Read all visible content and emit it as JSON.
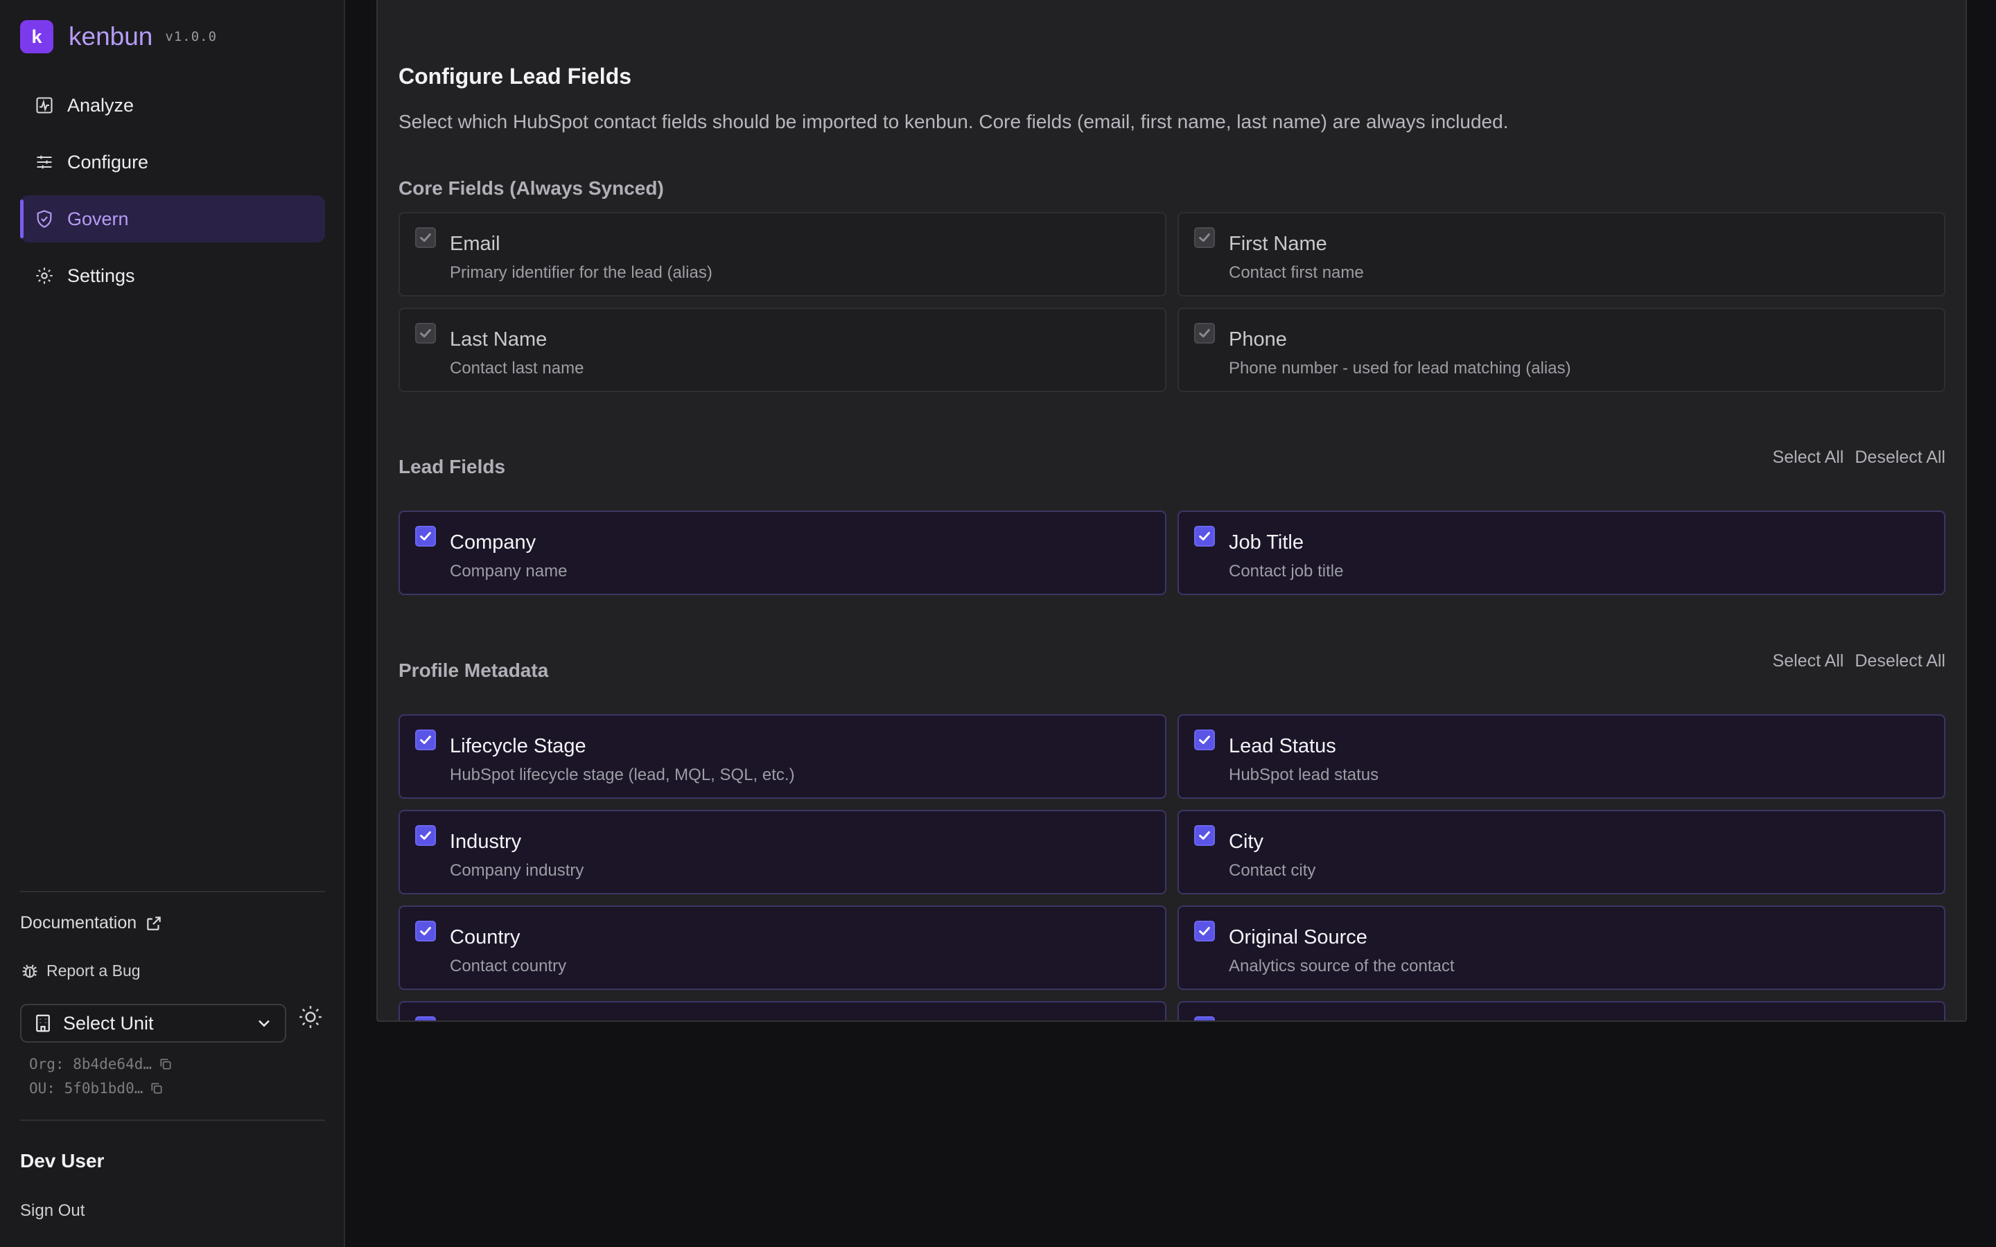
{
  "app": {
    "name": "kenbun",
    "version": "v1.0.0",
    "logo_letter": "k"
  },
  "nav": [
    {
      "label": "Analyze",
      "icon": "analyze-icon",
      "active": false
    },
    {
      "label": "Configure",
      "icon": "sliders-icon",
      "active": false
    },
    {
      "label": "Govern",
      "icon": "shield-icon",
      "active": true
    },
    {
      "label": "Settings",
      "icon": "gear-icon",
      "active": false
    }
  ],
  "sidebar_footer": {
    "documentation": "Documentation",
    "report_bug": "Report a Bug",
    "unit_select": "Select Unit",
    "org_id": "Org: 8b4de64d…",
    "ou_id": "OU: 5f0b1bd0…",
    "user_name": "Dev User",
    "sign_out": "Sign Out"
  },
  "main": {
    "title": "Configure Lead Fields",
    "description": "Select which HubSpot contact fields should be imported to kenbun. Core fields (email, first name, last name) are always included.",
    "sections": [
      {
        "title": "Core Fields (Always Synced)",
        "type": "core",
        "fields": [
          {
            "label": "Email",
            "desc": "Primary identifier for the lead (alias)"
          },
          {
            "label": "First Name",
            "desc": "Contact first name"
          },
          {
            "label": "Last Name",
            "desc": "Contact last name"
          },
          {
            "label": "Phone",
            "desc": "Phone number - used for lead matching (alias)"
          }
        ]
      },
      {
        "title": "Lead Fields",
        "type": "selectable",
        "select_all": "Select All",
        "deselect_all": "Deselect All",
        "fields": [
          {
            "label": "Company",
            "desc": "Company name"
          },
          {
            "label": "Job Title",
            "desc": "Contact job title"
          }
        ]
      },
      {
        "title": "Profile Metadata",
        "type": "selectable",
        "select_all": "Select All",
        "deselect_all": "Deselect All",
        "fields": [
          {
            "label": "Lifecycle Stage",
            "desc": "HubSpot lifecycle stage (lead, MQL, SQL, etc.)"
          },
          {
            "label": "Lead Status",
            "desc": "HubSpot lead status"
          },
          {
            "label": "Industry",
            "desc": "Company industry"
          },
          {
            "label": "City",
            "desc": "Contact city"
          },
          {
            "label": "Country",
            "desc": "Contact country"
          },
          {
            "label": "Original Source",
            "desc": "Analytics source of the contact"
          },
          {
            "label": "",
            "desc": ""
          },
          {
            "label": "",
            "desc": ""
          }
        ]
      }
    ]
  },
  "colors": {
    "accent": "#7c3aed",
    "checkbox": "#5a55e6",
    "active_nav_bg": "#2a2146"
  }
}
